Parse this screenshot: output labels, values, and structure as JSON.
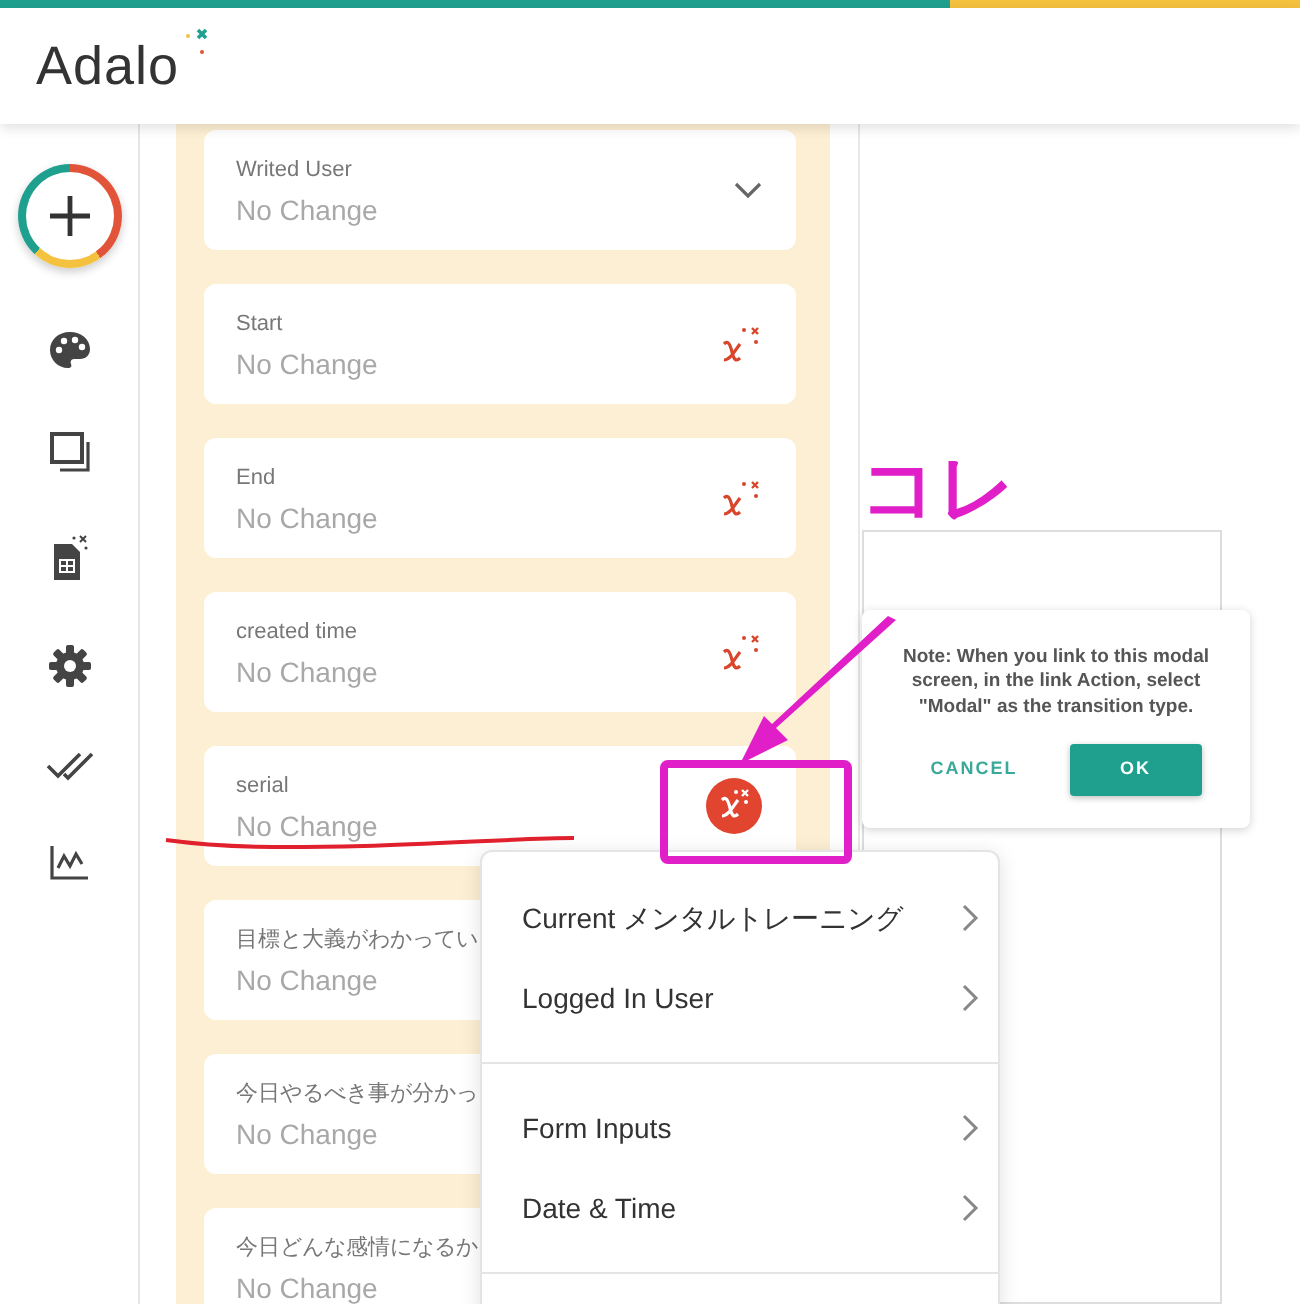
{
  "header": {
    "logo": "Adalo"
  },
  "fields": [
    {
      "label": "Writed User",
      "value": "No Change",
      "kind": "dropdown"
    },
    {
      "label": "Start",
      "value": "No Change",
      "kind": "magic",
      "active": false
    },
    {
      "label": "End",
      "value": "No Change",
      "kind": "magic",
      "active": false
    },
    {
      "label": "created time",
      "value": "No Change",
      "kind": "magic",
      "active": false
    },
    {
      "label": "serial",
      "value": "No Change",
      "kind": "magic",
      "active": true
    },
    {
      "label": "目標と大義がわかってい",
      "value": "No Change",
      "kind": "plain"
    },
    {
      "label": "今日やるべき事が分かっ",
      "value": "No Change",
      "kind": "plain"
    },
    {
      "label": "今日どんな感情になるか",
      "value": "No Change",
      "kind": "plain"
    }
  ],
  "menu": {
    "groups": [
      {
        "items": [
          {
            "label": "Current メンタルトレーニング"
          },
          {
            "label": "Logged In User"
          }
        ]
      },
      {
        "items": [
          {
            "label": "Form Inputs"
          },
          {
            "label": "Date & Time"
          }
        ]
      }
    ]
  },
  "modal": {
    "note": "Note: When you link to this modal screen, in the link Action, select \"Modal\" as the transition type.",
    "buttons": [
      {
        "label": "CANCEL",
        "kind": "text"
      },
      {
        "label": "OK",
        "kind": "primary"
      }
    ]
  },
  "annotation": {
    "text": "コレ"
  }
}
